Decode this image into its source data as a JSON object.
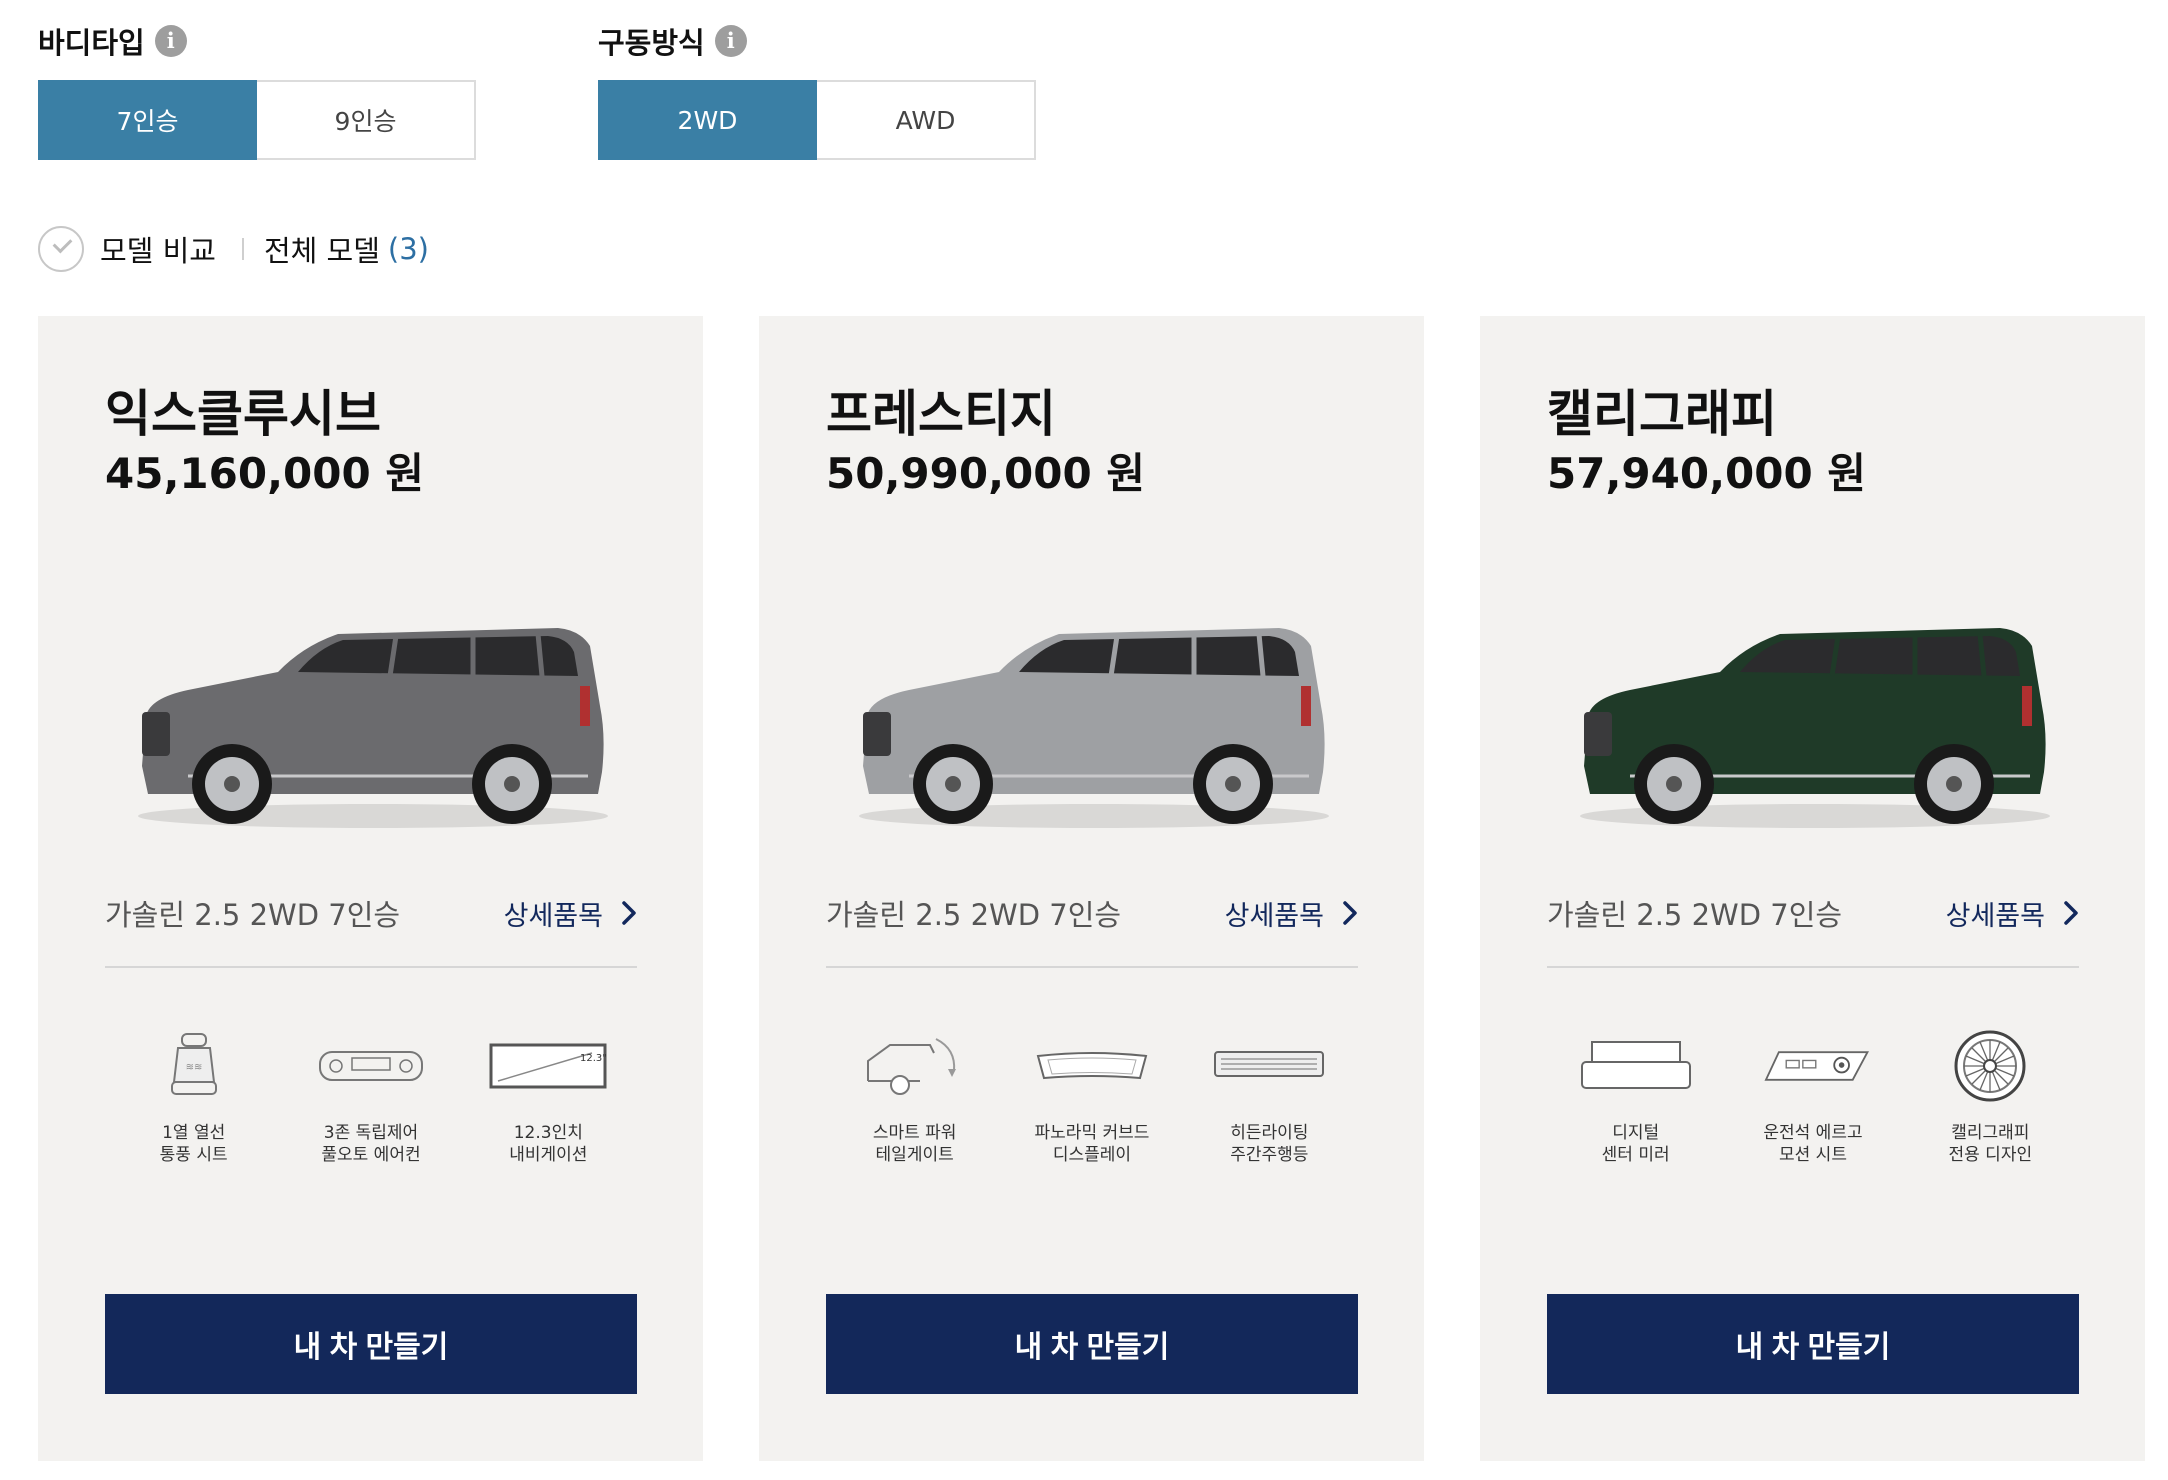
{
  "filters": {
    "body_type": {
      "title": "바디타입",
      "info": "i",
      "options": [
        "7인승",
        "9인승"
      ],
      "selected": "7인승"
    },
    "drive": {
      "title": "구동방식",
      "info": "i",
      "options": [
        "2WD",
        "AWD"
      ],
      "selected": "2WD"
    }
  },
  "compare": {
    "label": "모델 비교",
    "all_label": "전체 모델",
    "count": "(3)"
  },
  "colors": {
    "accent": "#3a7fa5",
    "cta": "#13285a",
    "card_bg": "#f3f2f0",
    "link": "#12285c"
  },
  "cards": [
    {
      "name": "익스클루시브",
      "price": "45,160,000 원",
      "car_color": "#6b6b6e",
      "trim": "가솔린 2.5 2WD 7인승",
      "detail": "상세품목",
      "cta": "내 차 만들기",
      "features": [
        {
          "icon": "heated-seat-icon",
          "label": "1열 열선\n통풍 시트"
        },
        {
          "icon": "climate-control-icon",
          "label": "3존 독립제어\n풀오토 에어컨"
        },
        {
          "icon": "navigation-screen-icon",
          "label": "12.3인치\n내비게이션",
          "badge": "12.3\""
        }
      ]
    },
    {
      "name": "프레스티지",
      "price": "50,990,000 원",
      "car_color": "#9ea0a3",
      "trim": "가솔린 2.5 2WD 7인승",
      "detail": "상세품목",
      "cta": "내 차 만들기",
      "features": [
        {
          "icon": "smart-tailgate-icon",
          "label": "스마트 파워\n테일게이트"
        },
        {
          "icon": "curved-display-icon",
          "label": "파노라믹 커브드\n디스플레이"
        },
        {
          "icon": "hidden-drl-icon",
          "label": "히든라이팅\n주간주행등"
        }
      ]
    },
    {
      "name": "캘리그래피",
      "price": "57,940,000 원",
      "car_color": "#1f3a28",
      "trim": "가솔린 2.5 2WD 7인승",
      "detail": "상세품목",
      "cta": "내 차 만들기",
      "features": [
        {
          "icon": "digital-mirror-icon",
          "label": "디지털\n센터 미러"
        },
        {
          "icon": "ergo-seat-icon",
          "label": "운전석 에르고\n모션 시트"
        },
        {
          "icon": "calligraphy-wheel-icon",
          "label": "캘리그래피\n전용 디자인"
        }
      ]
    }
  ]
}
